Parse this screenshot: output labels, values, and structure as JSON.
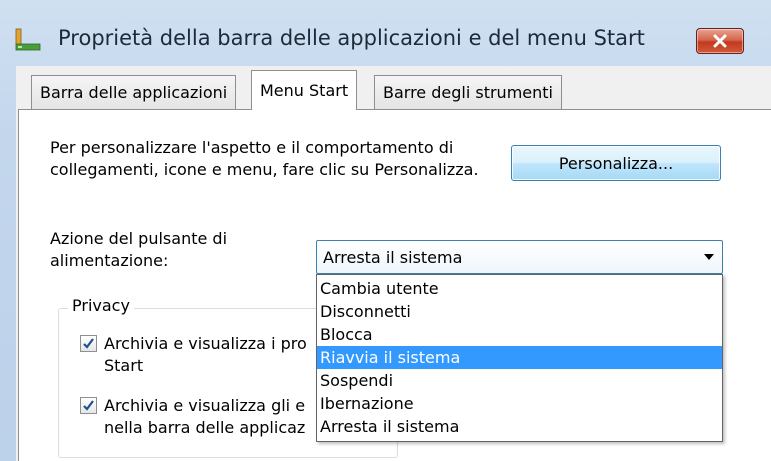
{
  "window": {
    "title": "Proprietà della barra delle applicazioni e del menu Start",
    "close_icon": "close-icon"
  },
  "tabs": [
    {
      "label": "Barra delle applicazioni",
      "active": false
    },
    {
      "label": "Menu Start",
      "active": true
    },
    {
      "label": "Barre degli strumenti",
      "active": false
    }
  ],
  "start_menu": {
    "description": "Per personalizzare l'aspetto e il comportamento di collegamenti, icone e menu, fare clic su Personalizza.",
    "customize_button": "Personalizza...",
    "power_label": "Azione del pulsante di alimentazione:",
    "power_selected": "Arresta il sistema",
    "power_options": [
      "Cambia utente",
      "Disconnetti",
      "Blocca",
      "Riavvia il sistema",
      "Sospendi",
      "Ibernazione",
      "Arresta il sistema"
    ],
    "highlighted_option": "Riavvia il sistema",
    "privacy": {
      "title": "Privacy",
      "items": [
        {
          "label": "Archivia e visualizza i programmi aperti di recente nel menu Start",
          "visible_text": "Archivia e visualizza i pro",
          "second_line": "Start",
          "checked": true
        },
        {
          "label": "Archivia e visualizza gli elementi aperti di recente nel menu Start e nella barra delle applicazioni",
          "visible_text": "Archivia e visualizza gli e",
          "second_line": "nella barra delle applicaz",
          "checked": true
        }
      ]
    }
  },
  "colors": {
    "selection": "#3399ff",
    "title_gradient": "#cfe0f1",
    "close_red": "#c2391f"
  }
}
